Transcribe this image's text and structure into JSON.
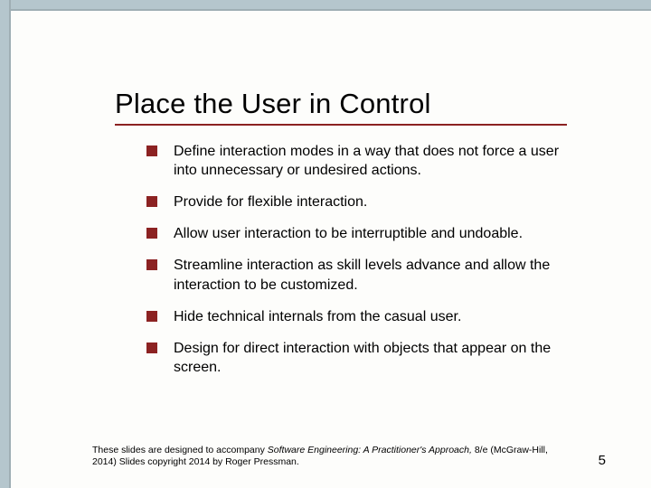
{
  "slide": {
    "title": "Place the User in Control",
    "bullets": [
      "Define interaction modes in a way that does not force a user into unnecessary or undesired actions.",
      "Provide for flexible interaction.",
      "Allow user interaction to be interruptible and undoable.",
      "Streamline interaction as skill levels advance and allow the interaction to be customized.",
      "Hide technical internals from the casual user.",
      "Design for direct interaction with objects that appear on the screen."
    ],
    "footer": {
      "prefix": "These slides are designed to accompany ",
      "book_title": "Software Engineering: A Practitioner's Approach,",
      "edition": " 8/e (McGraw-Hill, 2014) Slides copyright 2014 by Roger Pressman."
    },
    "page_number": "5"
  }
}
